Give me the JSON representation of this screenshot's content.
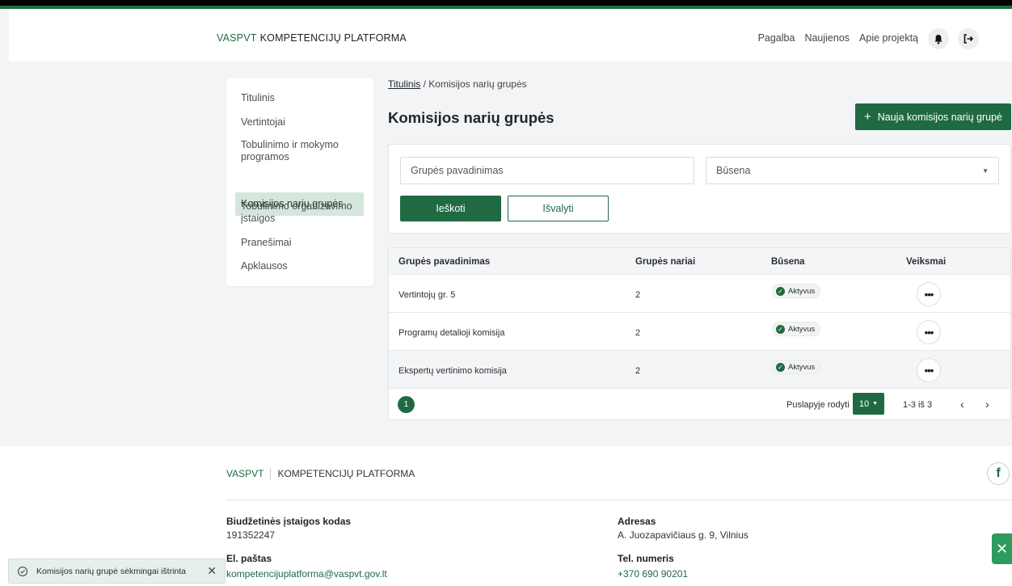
{
  "header": {
    "brand_short": "VASPVT",
    "brand_long": "KOMPETENCIJŲ PLATFORMA",
    "nav": [
      "Pagalba",
      "Naujienos",
      "Apie projektą"
    ]
  },
  "sidebar": {
    "items": [
      {
        "label": "Titulinis"
      },
      {
        "label": "Vertintojai"
      },
      {
        "label": "Tobulinimo ir mokymo programos"
      },
      {
        "label": "Komisijos narių grupės"
      },
      {
        "label": "Tobulinimo organizavimo įstaigos"
      },
      {
        "label": "Pranešimai"
      },
      {
        "label": "Apklausos"
      }
    ]
  },
  "breadcrumb": {
    "home": "Titulinis",
    "separator": "/",
    "current": "Komisijos narių grupės"
  },
  "page": {
    "title": "Komisijos narių grupės",
    "new_button": "Nauja komisijos narių grupė"
  },
  "filter": {
    "name_placeholder": "Grupės pavadinimas",
    "status_placeholder": "Būsena",
    "search_button": "Ieškoti",
    "clear_button": "Išvalyti"
  },
  "table": {
    "headers": [
      "Grupės pavadinimas",
      "Grupės nariai",
      "Būsena",
      "Veiksmai"
    ],
    "rows": [
      {
        "name": "Vertintojų gr. 5",
        "members": "2",
        "status": "Aktyvus"
      },
      {
        "name": "Programų detalioji komisija",
        "members": "2",
        "status": "Aktyvus"
      },
      {
        "name": "Ekspertų vertinimo komisija",
        "members": "2",
        "status": "Aktyvus"
      }
    ],
    "pager": {
      "current_page": "1",
      "per_page_label": "Puslapyje rodyti",
      "per_page_value": "10",
      "range": "1-3 iš 3"
    }
  },
  "footer": {
    "brand_short": "VASPVT",
    "brand_long": "KOMPETENCIJŲ PLATFORMA",
    "code_label": "Biudžetinės įstaigos kodas",
    "code_value": "191352247",
    "address_label": "Adresas",
    "address_value": "A. Juozapavičiaus g. 9, Vilnius",
    "email_label": "El. paštas",
    "email_value": "kompetencijuplatforma@vaspvt.gov.lt",
    "phone_label": "Tel. numeris",
    "phone_value": "+370 690 90201"
  },
  "toast": {
    "message": "Komisijos narių grupė sėkmingai ištrinta"
  },
  "colors": {
    "accent": "#1f6a43",
    "active_bg": "#d5e6dc"
  }
}
